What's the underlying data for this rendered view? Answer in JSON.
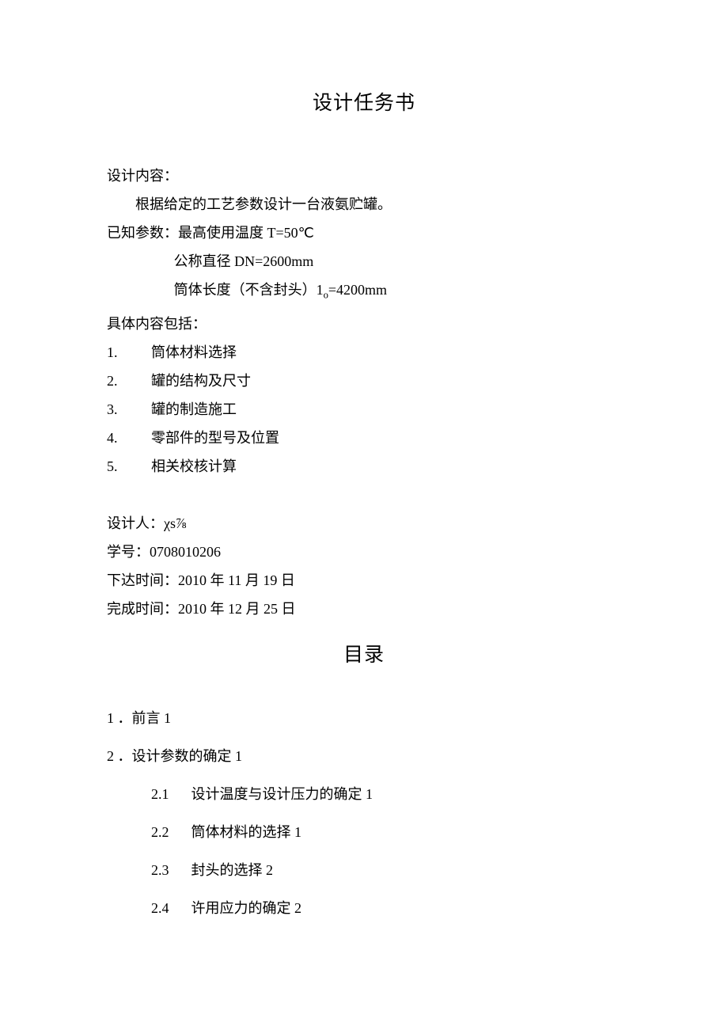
{
  "title": "设计任务书",
  "intro_label": "设计内容：",
  "intro_text": "根据给定的工艺参数设计一台液氨贮罐。",
  "params_label": "已知参数：",
  "param1": "最高使用温度 T=50℃",
  "param2": "公称直径 DN=2600mm",
  "param3_prefix": "筒体长度（不含封头）1",
  "param3_sub": "o",
  "param3_suffix": "=4200mm",
  "contents_label": "具体内容包括：",
  "items": [
    {
      "num": "1.",
      "text": "筒体材料选择"
    },
    {
      "num": "2.",
      "text": "罐的结构及尺寸"
    },
    {
      "num": "3.",
      "text": "罐的制造施工"
    },
    {
      "num": "4.",
      "text": "零部件的型号及位置"
    },
    {
      "num": "5.",
      "text": "相关校核计算"
    }
  ],
  "designer_label": "设计人：",
  "designer_value": "χs⅞",
  "student_id_label": "学号：",
  "student_id_value": "0708010206",
  "issue_label": "下达时间：",
  "issue_value": "2010 年 11 月 19 日",
  "complete_label": "完成时间：",
  "complete_value": "2010 年 12 月 25 日",
  "toc_title": "目录",
  "toc": [
    {
      "num": "1",
      "sep": "．",
      "text": "前言",
      "page": "1"
    },
    {
      "num": "2",
      "sep": "．",
      "text": "设计参数的确定",
      "page": "1"
    }
  ],
  "toc_sub": [
    {
      "num": "2.1",
      "text": "设计温度与设计压力的确定",
      "page": "1"
    },
    {
      "num": "2.2",
      "text": "筒体材料的选择",
      "page": "1"
    },
    {
      "num": "2.3",
      "text": "封头的选择",
      "page": "2"
    },
    {
      "num": "2.4",
      "text": "许用应力的确定",
      "page": "2"
    }
  ]
}
